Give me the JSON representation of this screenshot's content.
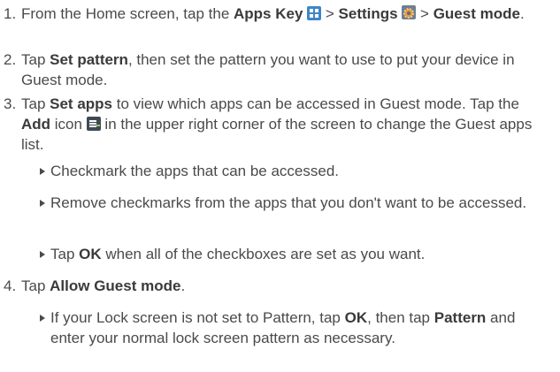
{
  "steps": [
    {
      "number": "1.",
      "parts": [
        {
          "t": "From the Home screen, tap the "
        },
        {
          "t": "Apps Key",
          "b": true
        },
        {
          "icon": "apps-icon"
        },
        {
          "t": " > "
        },
        {
          "t": "Settings",
          "b": true
        },
        {
          "icon": "settings-icon"
        },
        {
          "t": " > "
        },
        {
          "t": "Guest mode",
          "b": true
        },
        {
          "t": "."
        }
      ]
    },
    {
      "number": "2.",
      "parts": [
        {
          "t": "Tap "
        },
        {
          "t": "Set pattern",
          "b": true
        },
        {
          "t": ", then set the pattern you want to use to put your device in Guest mode."
        }
      ]
    },
    {
      "number": "3.",
      "parts": [
        {
          "t": "Tap "
        },
        {
          "t": "Set apps",
          "b": true
        },
        {
          "t": " to view which apps can be accessed in Guest mode. Tap the "
        },
        {
          "t": "Add",
          "b": true
        },
        {
          "t": " icon "
        },
        {
          "icon": "add-icon"
        },
        {
          "t": " in the upper right corner of the screen to change the Guest apps list."
        }
      ],
      "bullets": [
        [
          {
            "t": "Checkmark the apps that can be accessed."
          }
        ],
        [
          {
            "t": "Remove checkmarks from the apps that you don't want to be accessed."
          }
        ],
        [
          {
            "t": "Tap "
          },
          {
            "t": "OK",
            "b": true
          },
          {
            "t": " when all of the checkboxes are set as you want."
          }
        ]
      ]
    },
    {
      "number": "4.",
      "parts": [
        {
          "t": "Tap "
        },
        {
          "t": "Allow Guest mode",
          "b": true
        },
        {
          "t": "."
        }
      ],
      "bullets": [
        [
          {
            "t": "If your Lock screen is not set to Pattern, tap "
          },
          {
            "t": "OK",
            "b": true
          },
          {
            "t": ", then tap "
          },
          {
            "t": "Pattern",
            "b": true
          },
          {
            "t": " and enter your normal lock screen pattern as necessary."
          }
        ]
      ]
    }
  ],
  "icon_colors": {
    "apps-icon": "#3d86c8",
    "settings-icon": "#6e7f8f",
    "add-icon": "#3f4a55"
  }
}
